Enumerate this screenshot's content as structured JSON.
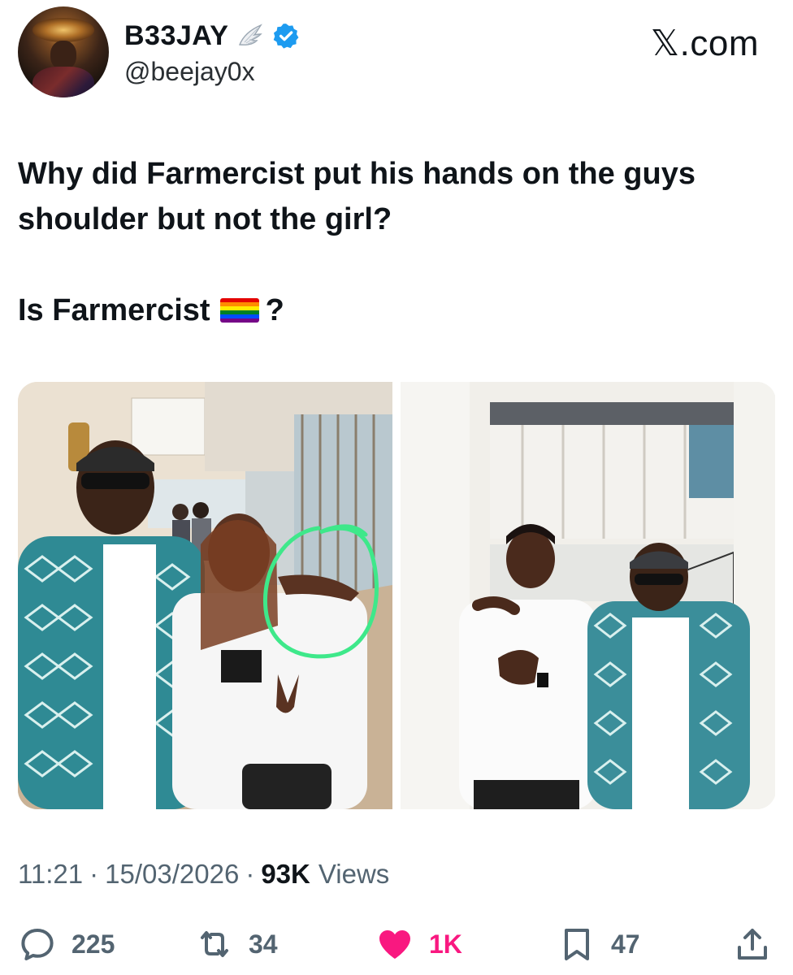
{
  "author": {
    "display_name": "B33JAY",
    "handle": "@beejay0x",
    "verified": true,
    "badges": [
      "wing-icon",
      "verified-check-icon"
    ]
  },
  "brand": "𝕏.com",
  "tweet": {
    "line1": "Why did Farmercist put his hands on the guys shoulder but not the girl?",
    "line2_prefix": "Is Farmercist",
    "line2_suffix": "?",
    "emoji": "rainbow-flag-icon"
  },
  "media": {
    "count": 2,
    "annotation_color": "#3ee88a"
  },
  "meta": {
    "time": "11:21",
    "date": "15/03/2026",
    "views_count": "93K",
    "views_label": "Views",
    "separator": "·"
  },
  "actions": {
    "replies": "225",
    "reposts": "34",
    "likes": "1K",
    "bookmarks": "47"
  },
  "colors": {
    "like_active": "#f91880",
    "verified": "#1d9bf0",
    "secondary_text": "#536471"
  }
}
